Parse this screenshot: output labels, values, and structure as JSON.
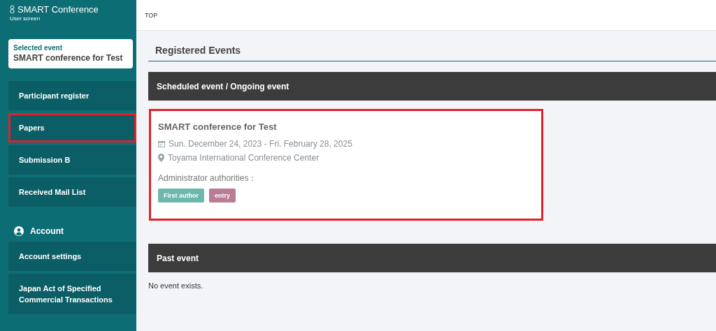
{
  "brand": {
    "title": "SMART Conference",
    "subtitle": "User screen"
  },
  "selected_event": {
    "label": "Selected event",
    "name": "SMART conference for Test"
  },
  "sidebar": {
    "items": [
      {
        "label": "Participant register",
        "highlighted": false
      },
      {
        "label": "Papers",
        "highlighted": true
      },
      {
        "label": "Submission B",
        "highlighted": false
      },
      {
        "label": "Received Mail List",
        "highlighted": false
      }
    ],
    "account": {
      "title": "Account",
      "items": [
        {
          "label": "Account settings",
          "highlighted": false
        },
        {
          "label": "Japan Act of Specified Commercial Transactions",
          "highlighted": false
        }
      ]
    }
  },
  "breadcrumb": "TOP",
  "page_title": "Registered Events",
  "sections": [
    {
      "title": "Scheduled event / Ongoing event",
      "events": [
        {
          "name": "SMART conference for Test",
          "dates": "Sun. December 24, 2023 - Fri. February 28, 2025",
          "venue": "Toyama International Conference Center",
          "authorities_label": "Administrator authorities：",
          "highlighted": true,
          "tags": [
            {
              "label": "First author",
              "color": "#6cb8ae"
            },
            {
              "label": "entry",
              "color": "#b97b95"
            }
          ]
        }
      ]
    },
    {
      "title": "Past event",
      "empty_text": "No event exists."
    }
  ]
}
